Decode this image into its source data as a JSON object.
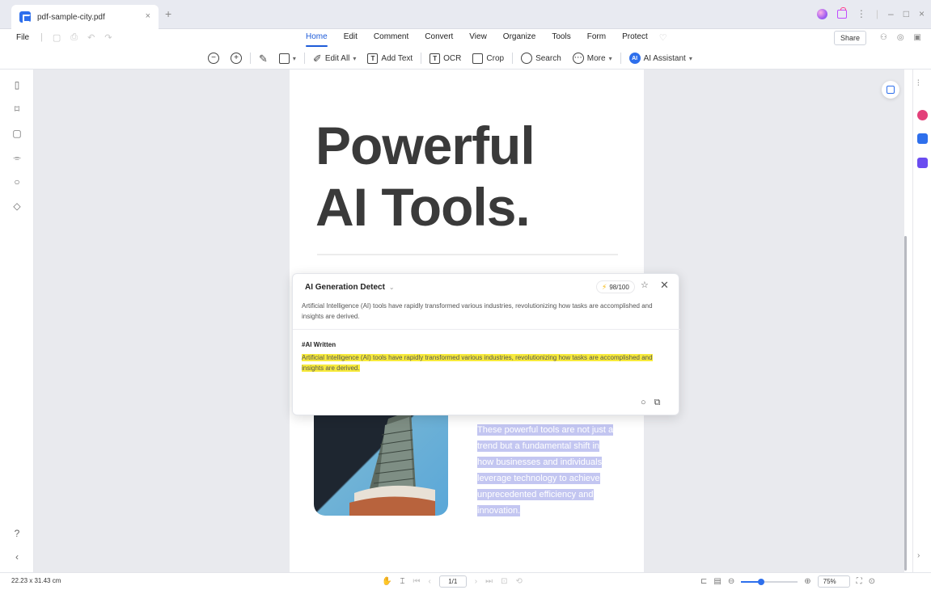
{
  "window": {
    "tab_title": "pdf-sample-city.pdf",
    "tab_close": "×",
    "tab_add": "+",
    "title_controls": {
      "more": "⋮",
      "minimize": "–",
      "maximize": "□",
      "close": "×"
    }
  },
  "menu": {
    "file": "File",
    "items": [
      {
        "label": "Home",
        "active": true
      },
      {
        "label": "Edit"
      },
      {
        "label": "Comment"
      },
      {
        "label": "Convert"
      },
      {
        "label": "View"
      },
      {
        "label": "Organize"
      },
      {
        "label": "Tools"
      },
      {
        "label": "Form"
      },
      {
        "label": "Protect"
      }
    ],
    "share": "Share"
  },
  "toolbar": {
    "edit_all": "Edit All",
    "add_text": "Add Text",
    "ocr": "OCR",
    "crop": "Crop",
    "search": "Search",
    "more": "More",
    "ai_assistant": "AI Assistant",
    "ai_badge": "AI",
    "add_text_glyph": "T",
    "ocr_glyph": "T"
  },
  "document": {
    "title_line1": "Powerful",
    "title_line2": "AI Tools.",
    "paragraph_lines": [
      "These powerful tools are not just a",
      "trend but a fundamental shift in",
      "how businesses and individuals",
      "leverage technology to achieve",
      "unprecedented efficiency and",
      "innovation."
    ]
  },
  "ai_detect": {
    "title": "AI Generation Detect",
    "score": "98/100",
    "source_text": "Artificial Intelligence (AI) tools have rapidly transformed various industries, revolutionizing how tasks are accomplished and insights are derived.",
    "result_tag": "#AI Written",
    "highlighted_text": "Artificial Intelligence (AI) tools have rapidly transformed various industries, revolutionizing how tasks are accomplished and insights are derived."
  },
  "status": {
    "dimensions": "22.23 x 31.43 cm",
    "page": "1/1",
    "zoom": "75%",
    "zoom_level": 0.35
  },
  "colors": {
    "accent": "#2e6fec",
    "highlight_yellow": "#f7ea3b",
    "selection_purple": "#c3c6f1"
  }
}
